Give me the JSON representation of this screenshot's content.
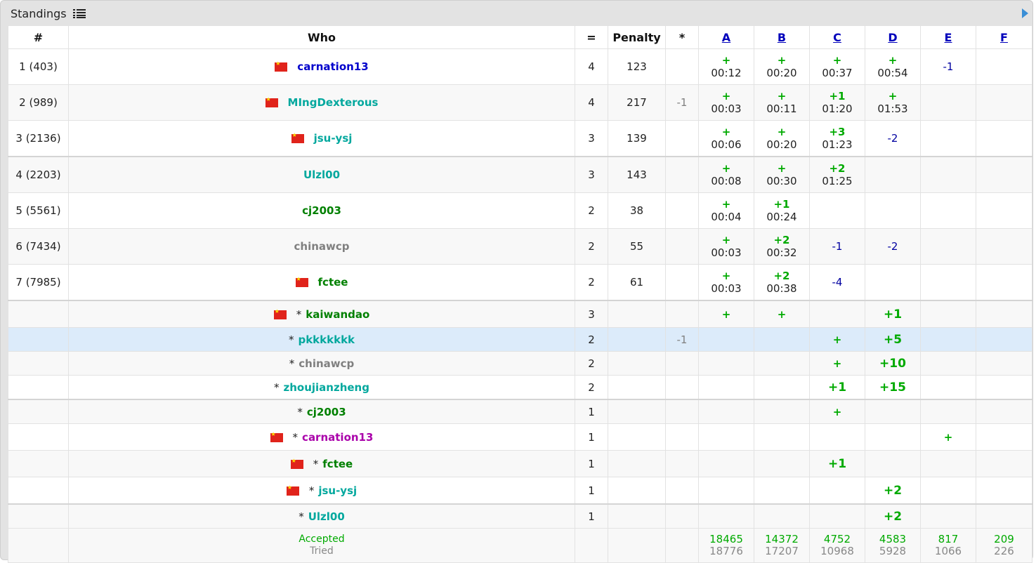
{
  "caption": {
    "title": "Standings",
    "list_icon": "list-icon",
    "expand_icon": "play-icon"
  },
  "headers": {
    "rank": "#",
    "who": "Who",
    "solved": "=",
    "penalty": "Penalty",
    "hacks": "*",
    "problems": [
      "A",
      "B",
      "C",
      "D",
      "E",
      "F"
    ]
  },
  "rows": [
    {
      "rank": "1 (403)",
      "flag": true,
      "star": false,
      "handle": "carnation13",
      "color": "blue",
      "solved": "4",
      "penalty": "123",
      "hacks": "",
      "cells": [
        {
          "r": "+",
          "t": "00:12"
        },
        {
          "r": "+",
          "t": "00:20"
        },
        {
          "r": "+",
          "t": "00:37"
        },
        {
          "r": "+",
          "t": "00:54"
        },
        {
          "r": "-1"
        },
        {}
      ]
    },
    {
      "rank": "2 (989)",
      "flag": true,
      "star": false,
      "handle": "MIngDexterous",
      "color": "cyan",
      "solved": "4",
      "penalty": "217",
      "hacks": "-1",
      "cells": [
        {
          "r": "+",
          "t": "00:03"
        },
        {
          "r": "+",
          "t": "00:11"
        },
        {
          "r": "+1",
          "t": "01:20"
        },
        {
          "r": "+",
          "t": "01:53"
        },
        {},
        {}
      ]
    },
    {
      "rank": "3 (2136)",
      "flag": true,
      "star": false,
      "handle": "jsu-ysj",
      "color": "cyan",
      "solved": "3",
      "penalty": "139",
      "hacks": "",
      "cells": [
        {
          "r": "+",
          "t": "00:06"
        },
        {
          "r": "+",
          "t": "00:20"
        },
        {
          "r": "+3",
          "t": "01:23"
        },
        {
          "r": "-2"
        },
        {},
        {}
      ]
    },
    {
      "rank": "4 (2203)",
      "flag": false,
      "star": false,
      "handle": "Ulzl00",
      "color": "cyan",
      "solved": "3",
      "penalty": "143",
      "hacks": "",
      "cells": [
        {
          "r": "+",
          "t": "00:08"
        },
        {
          "r": "+",
          "t": "00:30"
        },
        {
          "r": "+2",
          "t": "01:25"
        },
        {},
        {},
        {}
      ]
    },
    {
      "rank": "5 (5561)",
      "flag": false,
      "star": false,
      "handle": "cj2003",
      "color": "green",
      "solved": "2",
      "penalty": "38",
      "hacks": "",
      "cells": [
        {
          "r": "+",
          "t": "00:04"
        },
        {
          "r": "+1",
          "t": "00:24"
        },
        {},
        {},
        {},
        {}
      ]
    },
    {
      "rank": "6 (7434)",
      "flag": false,
      "star": false,
      "handle": "chinawcp",
      "color": "gray",
      "solved": "2",
      "penalty": "55",
      "hacks": "",
      "cells": [
        {
          "r": "+",
          "t": "00:03"
        },
        {
          "r": "+2",
          "t": "00:32"
        },
        {
          "r": "-1"
        },
        {
          "r": "-2"
        },
        {},
        {}
      ]
    },
    {
      "rank": "7 (7985)",
      "flag": true,
      "star": false,
      "handle": "fctee",
      "color": "green",
      "solved": "2",
      "penalty": "61",
      "hacks": "",
      "cells": [
        {
          "r": "+",
          "t": "00:03"
        },
        {
          "r": "+2",
          "t": "00:38"
        },
        {
          "r": "-4"
        },
        {},
        {},
        {}
      ]
    },
    {
      "rank": "",
      "flag": true,
      "star": true,
      "handle": "kaiwandao",
      "color": "green",
      "solved": "3",
      "penalty": "",
      "hacks": "",
      "cells": [
        {
          "r": "+"
        },
        {
          "r": "+"
        },
        {},
        {
          "r": "+1"
        },
        {},
        {}
      ]
    },
    {
      "rank": "",
      "flag": false,
      "star": true,
      "handle": "pkkkkkkk",
      "color": "cyan",
      "solved": "2",
      "penalty": "",
      "hacks": "-1",
      "cells": [
        {},
        {},
        {
          "r": "+"
        },
        {
          "r": "+5"
        },
        {},
        {}
      ]
    },
    {
      "rank": "",
      "flag": false,
      "star": true,
      "handle": "chinawcp",
      "color": "gray",
      "solved": "2",
      "penalty": "",
      "hacks": "",
      "cells": [
        {},
        {},
        {
          "r": "+"
        },
        {
          "r": "+10"
        },
        {},
        {}
      ]
    },
    {
      "rank": "",
      "flag": false,
      "star": true,
      "handle": "zhoujianzheng",
      "color": "cyan",
      "solved": "2",
      "penalty": "",
      "hacks": "",
      "cells": [
        {},
        {},
        {
          "r": "+1"
        },
        {
          "r": "+15"
        },
        {},
        {}
      ]
    },
    {
      "rank": "",
      "flag": false,
      "star": true,
      "handle": "cj2003",
      "color": "green",
      "solved": "1",
      "penalty": "",
      "hacks": "",
      "cells": [
        {},
        {},
        {
          "r": "+"
        },
        {},
        {},
        {}
      ]
    },
    {
      "rank": "",
      "flag": true,
      "star": true,
      "handle": "carnation13",
      "color": "violet",
      "solved": "1",
      "penalty": "",
      "hacks": "",
      "cells": [
        {},
        {},
        {},
        {},
        {
          "r": "+"
        },
        {}
      ]
    },
    {
      "rank": "",
      "flag": true,
      "star": true,
      "handle": "fctee",
      "color": "green",
      "solved": "1",
      "penalty": "",
      "hacks": "",
      "cells": [
        {},
        {},
        {
          "r": "+1"
        },
        {},
        {},
        {}
      ]
    },
    {
      "rank": "",
      "flag": true,
      "star": true,
      "handle": "jsu-ysj",
      "color": "cyan",
      "solved": "1",
      "penalty": "",
      "hacks": "",
      "cells": [
        {},
        {},
        {},
        {
          "r": "+2"
        },
        {},
        {}
      ]
    },
    {
      "rank": "",
      "flag": false,
      "star": true,
      "handle": "Ulzl00",
      "color": "cyan",
      "solved": "1",
      "penalty": "",
      "hacks": "",
      "cells": [
        {},
        {},
        {},
        {
          "r": "+2"
        },
        {},
        {}
      ]
    }
  ],
  "footer": {
    "accepted_label": "Accepted",
    "tried_label": "Tried",
    "accepted": [
      "18465",
      "14372",
      "4752",
      "4583",
      "817",
      "209"
    ],
    "tried": [
      "18776",
      "17207",
      "10968",
      "5928",
      "1066",
      "226"
    ]
  },
  "colors": {
    "blue": "#0000cc",
    "cyan": "#03a89e",
    "green": "#008000",
    "gray": "#808080",
    "violet": "#aa00aa",
    "accepted": "#00aa00",
    "rejected": "#0000a0",
    "highlight": "#dcebfa"
  }
}
